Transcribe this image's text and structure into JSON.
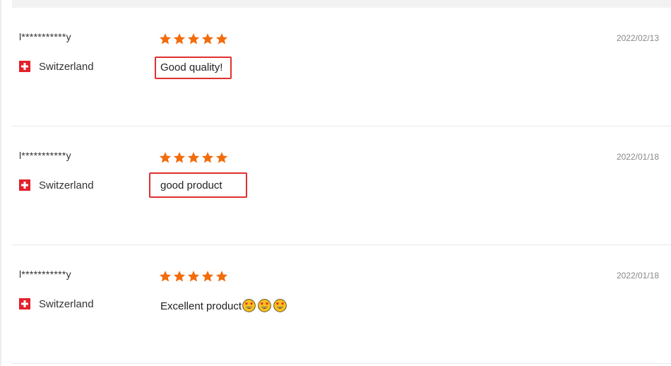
{
  "reviews": [
    {
      "user": "l***********y",
      "country": "Switzerland",
      "rating": 5,
      "text": "Good quality!",
      "date": "2022/02/13",
      "emoji_count": 0
    },
    {
      "user": "l***********y",
      "country": "Switzerland",
      "rating": 5,
      "text": "good product",
      "date": "2022/01/18",
      "emoji_count": 0
    },
    {
      "user": "l***********y",
      "country": "Switzerland",
      "rating": 5,
      "text": "Excellent product",
      "date": "2022/01/18",
      "emoji_count": 3
    }
  ],
  "icons": {
    "flag": "switzerland-flag-icon",
    "star": "star-icon",
    "emoji": "heart-eyes-emoji-icon"
  },
  "colors": {
    "star": "#f26c0c",
    "flag_red": "#e3212b",
    "highlight_border": "#e03030",
    "date_text": "#888888",
    "divider": "#e8e8e8"
  }
}
